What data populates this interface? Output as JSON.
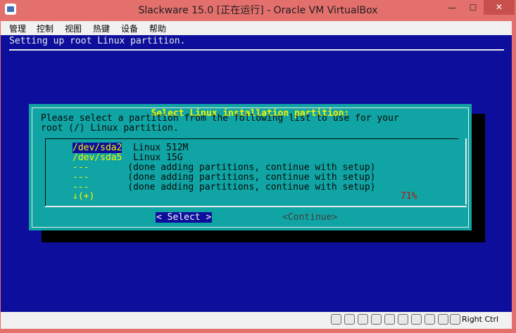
{
  "window": {
    "title": "Slackware 15.0 [正在运行] - Oracle VM VirtualBox",
    "controls": {
      "minimize": "—",
      "maximize": "☐",
      "close": "✕"
    }
  },
  "menu": [
    "管理",
    "控制",
    "视图",
    "热键",
    "设备",
    "帮助"
  ],
  "screen": {
    "header": "Setting up root Linux partition.",
    "dialog": {
      "title": "Select Linux installation partition:",
      "prompt_line1": "Please select a partition from the following list to use for your",
      "prompt_line2": "root (/) Linux partition.",
      "items": [
        {
          "device": "/dev/sda2",
          "desc": "Linux 512M",
          "selected": true
        },
        {
          "device": "/dev/sda5",
          "desc": "Linux 15G",
          "selected": false
        },
        {
          "device": "---",
          "desc": "(done adding partitions, continue with setup)",
          "selected": false
        },
        {
          "device": "---",
          "desc": "(done adding partitions, continue with setup)",
          "selected": false
        },
        {
          "device": "---",
          "desc": "(done adding partitions, continue with setup)",
          "selected": false
        }
      ],
      "scroll_indicator": "↓(+)",
      "scroll_percent": "71%",
      "select_button": "< Select >",
      "continue_button": "<Continue>"
    }
  },
  "statusbar": {
    "icons": [
      "hard-disk-icon",
      "optical-drive-icon",
      "audio-icon",
      "network-icon",
      "usb-icon",
      "shared-folder-icon",
      "display-icon",
      "video-capture-icon",
      "virtualization-icon",
      "mouse-integration-icon"
    ],
    "host_key": "Right Ctrl"
  },
  "colors": {
    "vm_background": "#0d0f9c",
    "dialog_background": "#10a4a4",
    "highlight_text": "#f5f500",
    "percent_text": "#c01010",
    "window_frame": "#e4706d"
  }
}
